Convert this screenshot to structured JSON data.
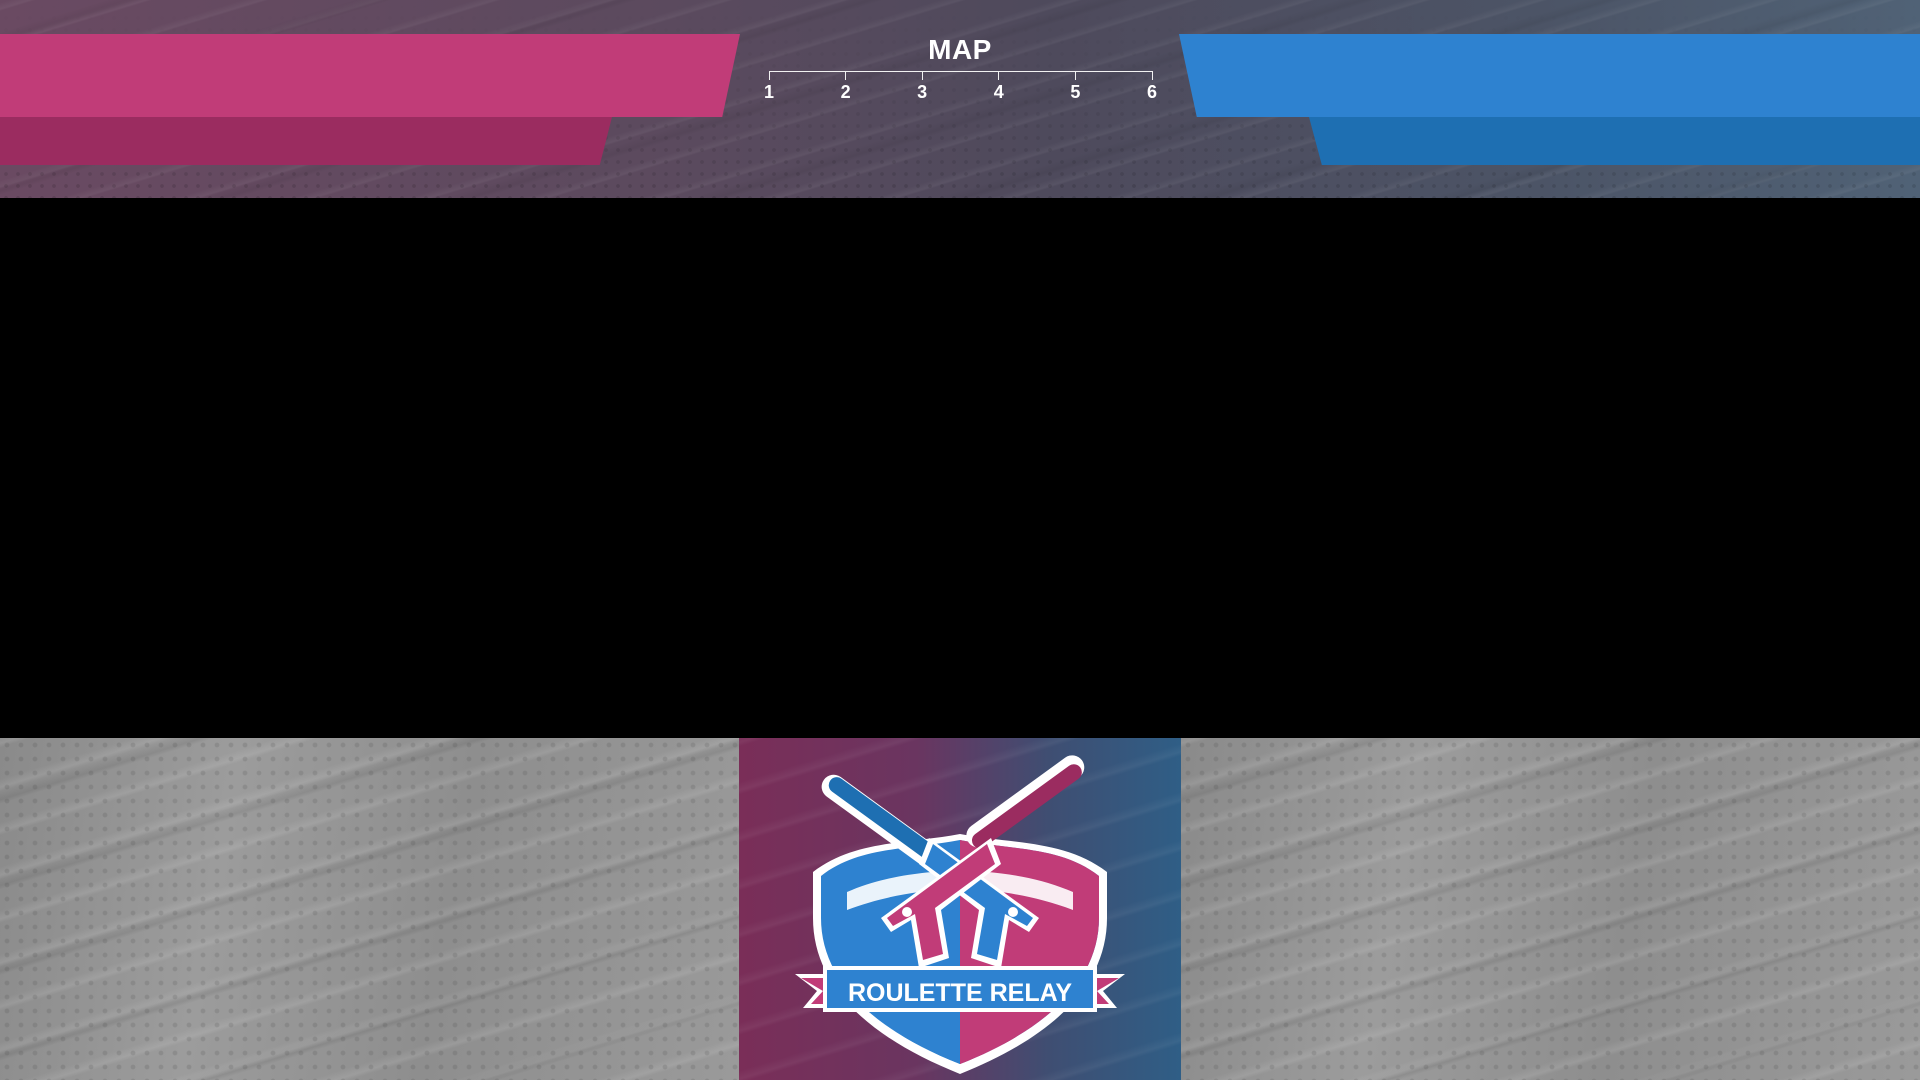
{
  "overlay": {
    "name": "Roulette Relay broadcast overlay"
  },
  "teams": {
    "left": {
      "name": "",
      "color": "#c13c78",
      "secondary_color": "#9b2c60"
    },
    "right": {
      "name": "",
      "color": "#2e82d0",
      "secondary_color": "#1e6fb2"
    }
  },
  "map_tracker": {
    "title": "MAP",
    "steps": [
      "1",
      "2",
      "3",
      "4",
      "5",
      "6"
    ]
  },
  "logo": {
    "text": "ROULETTE RELAY",
    "icons": [
      "shield-icon",
      "pistol-icon",
      "silencer-icon"
    ],
    "colors": {
      "pink": "#c13c78",
      "blue": "#2e82d0",
      "outline": "#ffffff"
    }
  }
}
